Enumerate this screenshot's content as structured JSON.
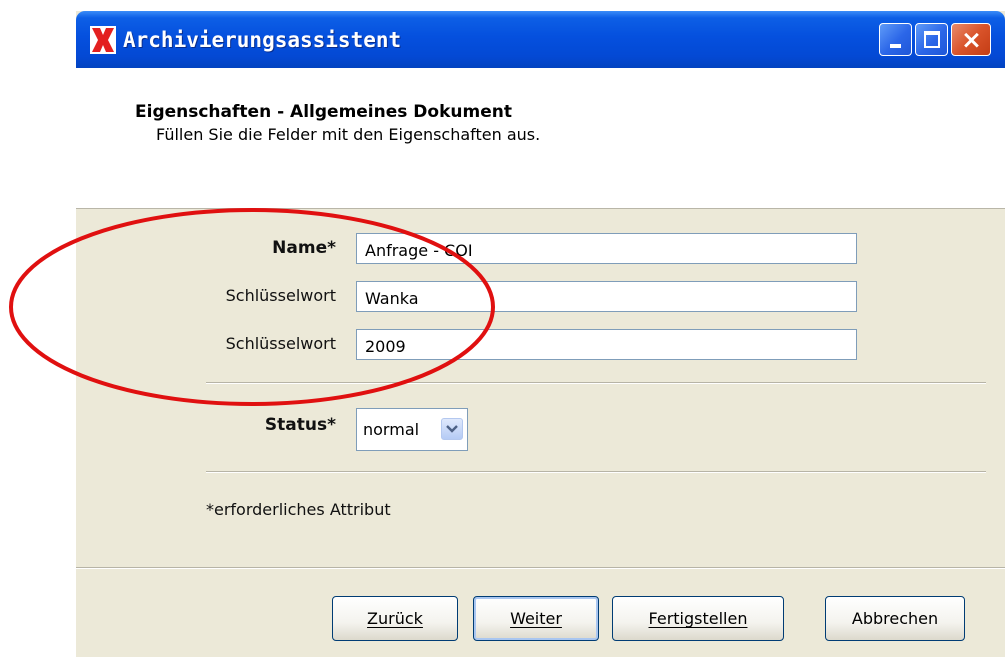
{
  "window": {
    "title": "Archivierungsassistent",
    "controls": {
      "minimize": "minimize-icon",
      "maximize": "maximize-icon",
      "close": "close-icon"
    }
  },
  "header": {
    "title": "Eigenschaften - Allgemeines Dokument",
    "subtitle": "Füllen Sie die Felder mit den Eigenschaften aus."
  },
  "form": {
    "name_label": "Name*",
    "name_value": "Anfrage - COI",
    "keyword1_label": "Schlüsselwort",
    "keyword1_value": "Wanka",
    "keyword2_label": "Schlüsselwort",
    "keyword2_value": "2009",
    "status_label": "Status*",
    "status_value": "normal",
    "required_note": "*erforderliches Attribut"
  },
  "buttons": {
    "back": "Zurück",
    "next": "Weiter",
    "finish": "Fertigstellen",
    "cancel": "Abbrechen"
  },
  "colors": {
    "titlebar": "#0550de",
    "window_bg": "#ece9d8",
    "annotation": "#e01010"
  }
}
